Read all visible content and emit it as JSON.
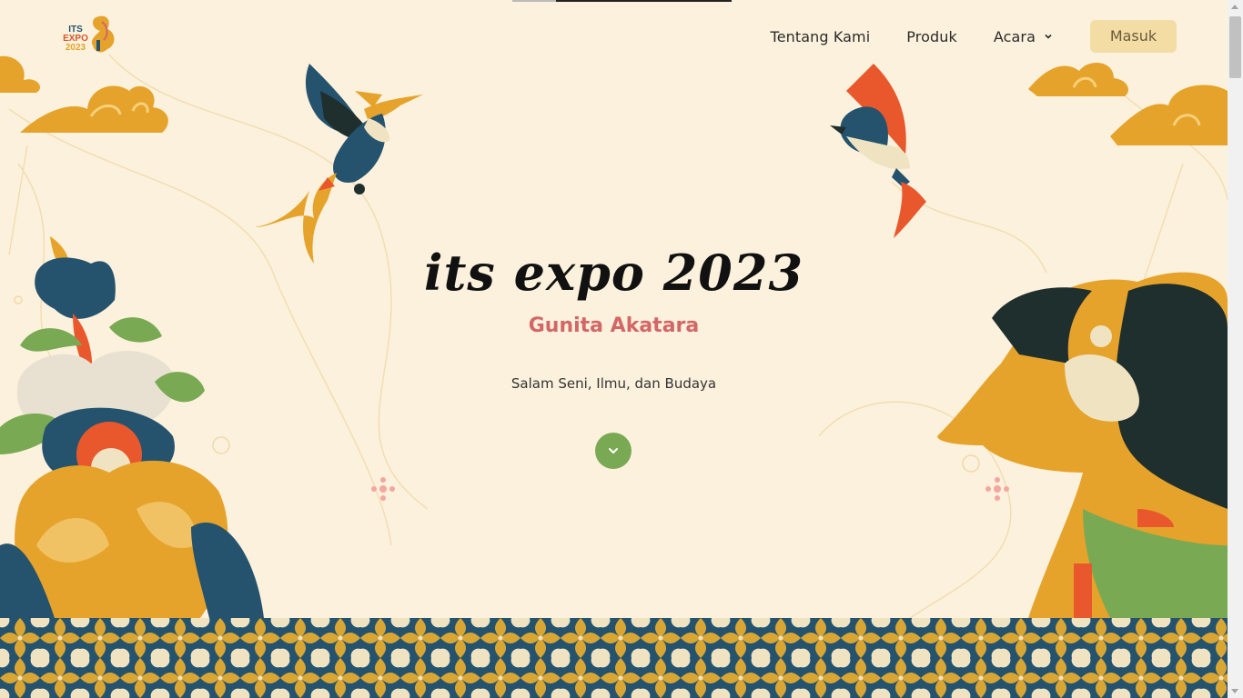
{
  "header": {
    "logo_lines": [
      "ITS",
      "EXPO",
      "2023"
    ],
    "nav": [
      {
        "label": "Tentang Kami"
      },
      {
        "label": "Produk"
      },
      {
        "label": "Acara",
        "has_dropdown": true
      }
    ],
    "login_label": "Masuk"
  },
  "hero": {
    "title": "its expo 2023",
    "subtitle": "Gunita Akatara",
    "tagline": "Salam Seni, Ilmu, dan Budaya"
  },
  "colors": {
    "background": "#fcf1dc",
    "subtitle": "#d36667",
    "scroll_button": "#7aa954",
    "login_button": "#f3dda4",
    "batik_blue": "#25536e",
    "batik_gold": "#d9a634"
  },
  "icons": {
    "scroll_button": "chevron-down-icon",
    "acara_dropdown": "chevron-down-icon"
  }
}
